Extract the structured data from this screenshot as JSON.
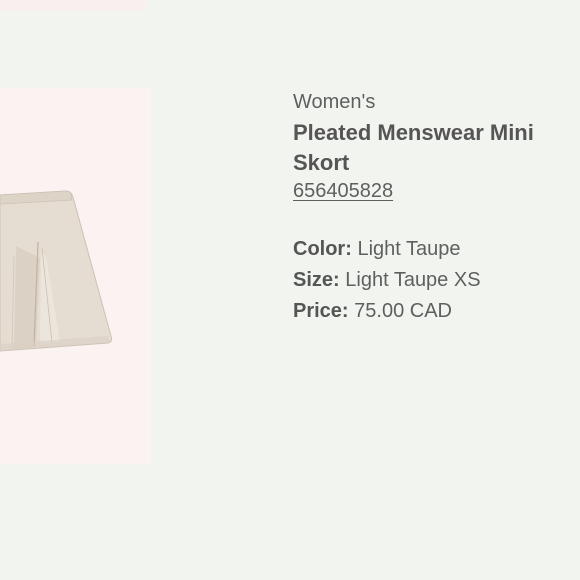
{
  "product": {
    "category": "Women's",
    "name": "Pleated Menswear Mini\nSkort",
    "code": "656405828",
    "color_label": "Color:",
    "color_value": "Light Taupe",
    "size_label": "Size:",
    "size_value": "Light Taupe XS",
    "price_label": "Price:",
    "price_value": "75.00 CAD"
  },
  "colors": {
    "page_background": "#f2f5ef",
    "image_background": "#fbf3f1",
    "skirt_fabric": "#e4dbd0",
    "text": "#555555"
  }
}
